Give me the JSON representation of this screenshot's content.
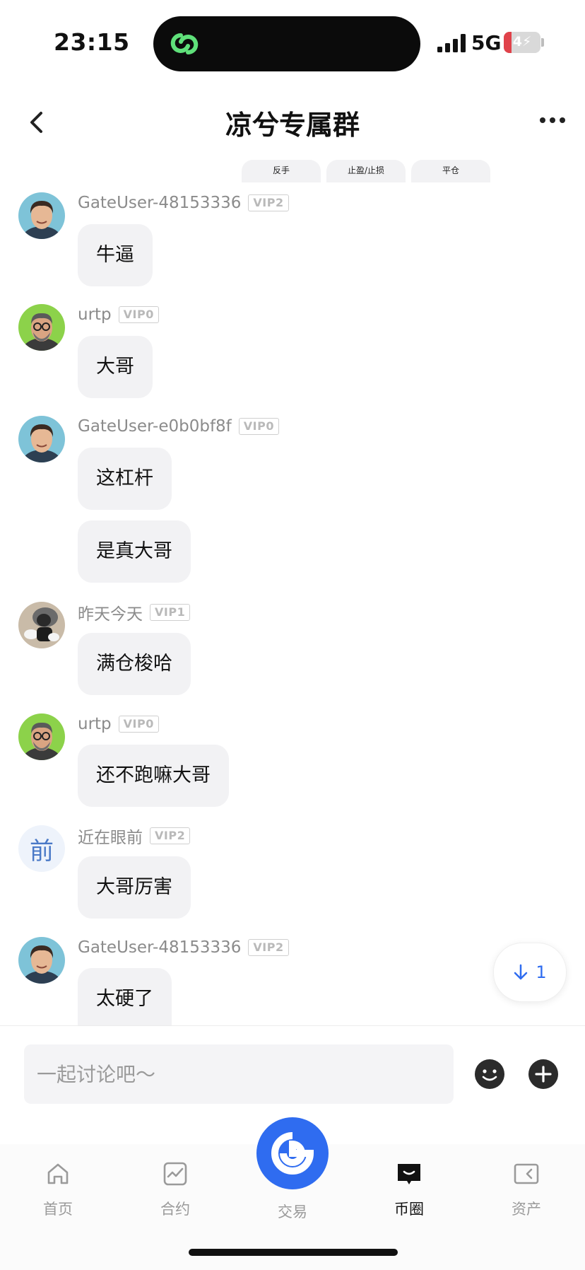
{
  "status_bar": {
    "time": "23:15",
    "network": "5G",
    "battery": "4"
  },
  "header": {
    "title": "凉兮专属群"
  },
  "actions": [
    "反手",
    "止盈/止损",
    "平仓"
  ],
  "messages": [
    {
      "user": "GateUser-48153336",
      "vip": "VIP2",
      "avatar": "man-smile",
      "bubbles": [
        "牛逼"
      ]
    },
    {
      "user": "urtp",
      "vip": "VIP0",
      "avatar": "man-glasses",
      "bubbles": [
        "大哥"
      ]
    },
    {
      "user": "GateUser-e0b0bf8f",
      "vip": "VIP0",
      "avatar": "man-smile",
      "bubbles": [
        "这杠杆",
        "是真大哥"
      ]
    },
    {
      "user": "昨天今天",
      "vip": "VIP1",
      "avatar": "figure-toy",
      "bubbles": [
        "满仓梭哈"
      ]
    },
    {
      "user": "urtp",
      "vip": "VIP0",
      "avatar": "man-glasses",
      "bubbles": [
        "还不跑嘛大哥"
      ]
    },
    {
      "user": "近在眼前",
      "vip": "VIP2",
      "avatar": "text-avatar",
      "avatar_text": "前",
      "bubbles": [
        "大哥厉害"
      ]
    },
    {
      "user": "GateUser-48153336",
      "vip": "VIP2",
      "avatar": "man-smile",
      "bubbles": [
        "太硬了"
      ]
    }
  ],
  "scroll_badge": {
    "count": "1"
  },
  "input": {
    "placeholder": "一起讨论吧～"
  },
  "tabs": [
    {
      "label": "首页",
      "icon": "home-icon",
      "active": false
    },
    {
      "label": "合约",
      "icon": "contract-chart-icon",
      "active": false
    },
    {
      "label": "交易",
      "icon": "trade-logo-icon",
      "active": false
    },
    {
      "label": "币圈",
      "icon": "chat-bubble-icon",
      "active": true
    },
    {
      "label": "资产",
      "icon": "wallet-icon",
      "active": false
    }
  ],
  "colors": {
    "accent": "#2f6cf0",
    "bubble": "#f2f2f4",
    "vip_border": "#cfcfcf",
    "battery_low": "#e0424a"
  }
}
